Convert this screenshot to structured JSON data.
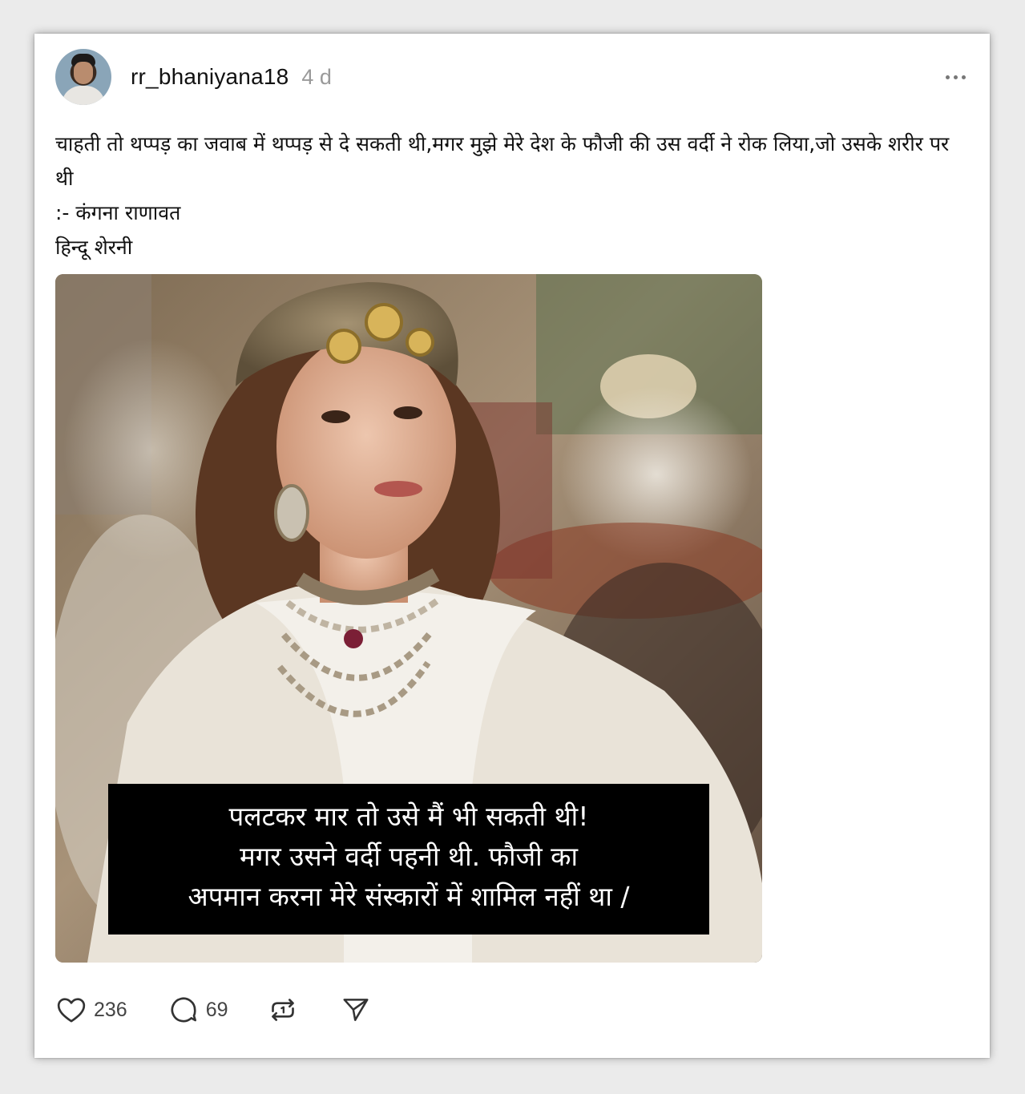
{
  "post": {
    "username": "rr_bhaniyana18",
    "timestamp": "4 d",
    "caption_lines": [
      "चाहती तो थप्पड़ का जवाब में थप्पड़ से दे सकती थी,मगर मुझे मेरे देश के फौजी की उस वर्दी ने रोक लिया,जो उसके शरीर पर थी",
      ":- कंगना राणावत",
      "हिन्दू शेरनी"
    ],
    "image_overlay_lines": [
      "पलटकर मार तो उसे मैं भी सकती थी!",
      "मगर उसने वर्दी पहनी थी. फौजी का",
      "अपमान करना मेरे संस्कारों में शामिल नहीं था /"
    ],
    "likes": "236",
    "replies": "69"
  },
  "icons": {
    "more": "more-horizontal-icon",
    "like": "heart-icon",
    "reply": "speech-bubble-icon",
    "repost": "repost-icon",
    "share": "send-icon"
  },
  "colors": {
    "text": "#111111",
    "muted": "#9a9a9a",
    "overlay_bg": "#000000",
    "overlay_text": "#ffffff"
  }
}
